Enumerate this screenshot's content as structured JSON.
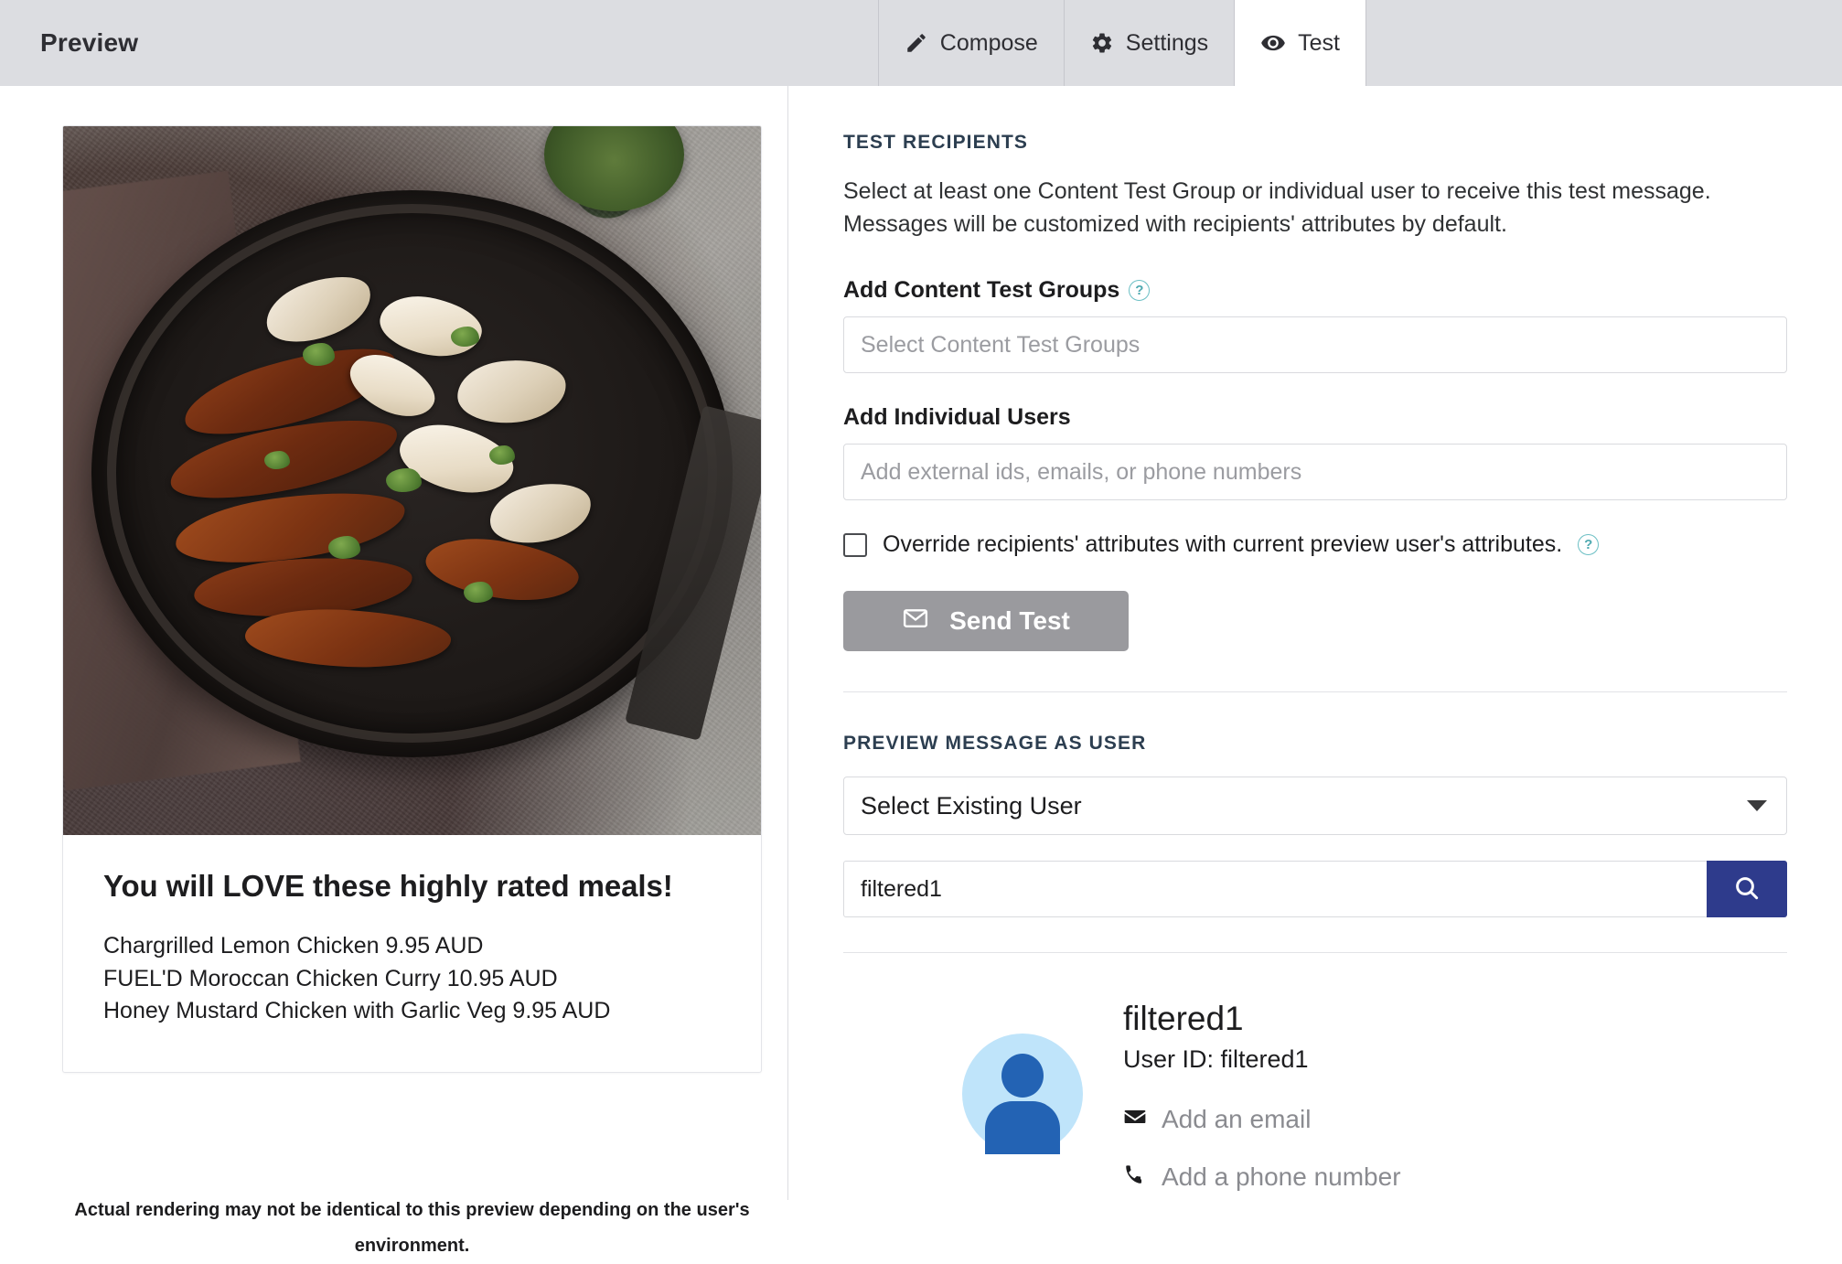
{
  "topbar": {
    "title": "Preview",
    "tabs": [
      {
        "label": "Compose",
        "icon": "pencil-icon",
        "active": false
      },
      {
        "label": "Settings",
        "icon": "gear-icon",
        "active": false
      },
      {
        "label": "Test",
        "icon": "eye-icon",
        "active": true
      }
    ]
  },
  "preview": {
    "headline": "You will LOVE these highly rated meals!",
    "items": [
      "Chargrilled Lemon Chicken  9.95 AUD",
      "FUEL'D Moroccan Chicken Curry  10.95 AUD",
      "Honey Mustard Chicken with Garlic Veg  9.95 AUD"
    ],
    "disclaimer": "Actual rendering may not be identical to this preview depending on the user's environment.",
    "image_alt": "skillet-of-glazed-chicken-photo"
  },
  "test_recipients": {
    "heading": "TEST RECIPIENTS",
    "description": "Select at least one Content Test Group or individual user to receive this test message. Messages will be customized with recipients' attributes by default.",
    "content_test_groups": {
      "label": "Add Content Test Groups",
      "help": "?",
      "value": "",
      "placeholder": "Select Content Test Groups"
    },
    "individual_users": {
      "label": "Add Individual Users",
      "value": "",
      "placeholder": "Add external ids, emails, or phone numbers"
    },
    "override_checkbox": {
      "label": "Override recipients' attributes with current preview user's attributes.",
      "checked": false,
      "help": "?"
    },
    "send_button": {
      "label": "Send Test",
      "icon": "envelope-icon",
      "color": "#9a9a9e",
      "disabled": true
    }
  },
  "preview_as_user": {
    "heading": "PREVIEW MESSAGE AS USER",
    "select": {
      "value": "Select Existing User",
      "icon": "chevron-down-icon"
    },
    "search": {
      "value": "filtered1",
      "placeholder": "",
      "button_icon": "search-icon",
      "button_color": "#2e3b8c"
    },
    "result": {
      "name": "filtered1",
      "user_id_label": "User ID: filtered1",
      "actions": [
        {
          "label": "Add an email",
          "icon": "envelope-icon"
        },
        {
          "label": "Add a phone number",
          "icon": "phone-icon"
        }
      ],
      "avatar_icon": "person-avatar-icon"
    }
  },
  "colors": {
    "topbar_bg": "#dcdde1",
    "accent_blue": "#2e3b8c",
    "help_teal": "#6bbfc4",
    "muted_gray": "#9a9a9e",
    "eyebrow": "#2c3e50"
  }
}
